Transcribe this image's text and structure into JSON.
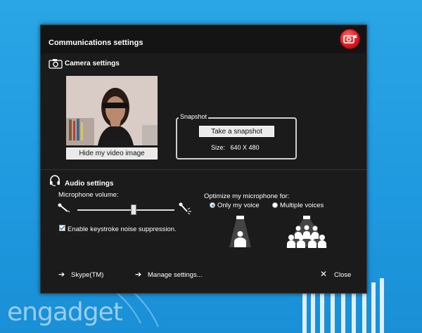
{
  "watermark": "engadget",
  "dialog": {
    "title": "Communications settings",
    "close_icon": "camera-close-icon"
  },
  "camera": {
    "heading": "Camera settings",
    "hide_button": "Hide my video image",
    "snapshot_group": "Snapshot",
    "snapshot_button": "Take a snapshot",
    "size_label": "Size:",
    "size_value": "640 X 480"
  },
  "audio": {
    "heading": "Audio settings",
    "mic_volume_label": "Microphone volume:",
    "mic_volume_level": 0.58,
    "noise_suppression_label": "Enable keystroke noise suppression.",
    "noise_suppression_checked": true,
    "optimize_label": "Optimize my microphone for:",
    "options": [
      "Only my voice",
      "Multiple voices"
    ],
    "selected_option": "Only my voice"
  },
  "footer": {
    "skype_link": "Skype(TM)",
    "manage_link": "Manage settings...",
    "close_label": "Close"
  },
  "colors": {
    "accent": "#2a7de1",
    "close_red": "#d6171d",
    "dialog_bg": "#1b1b1b",
    "page_bg": "#2aa6e6"
  }
}
